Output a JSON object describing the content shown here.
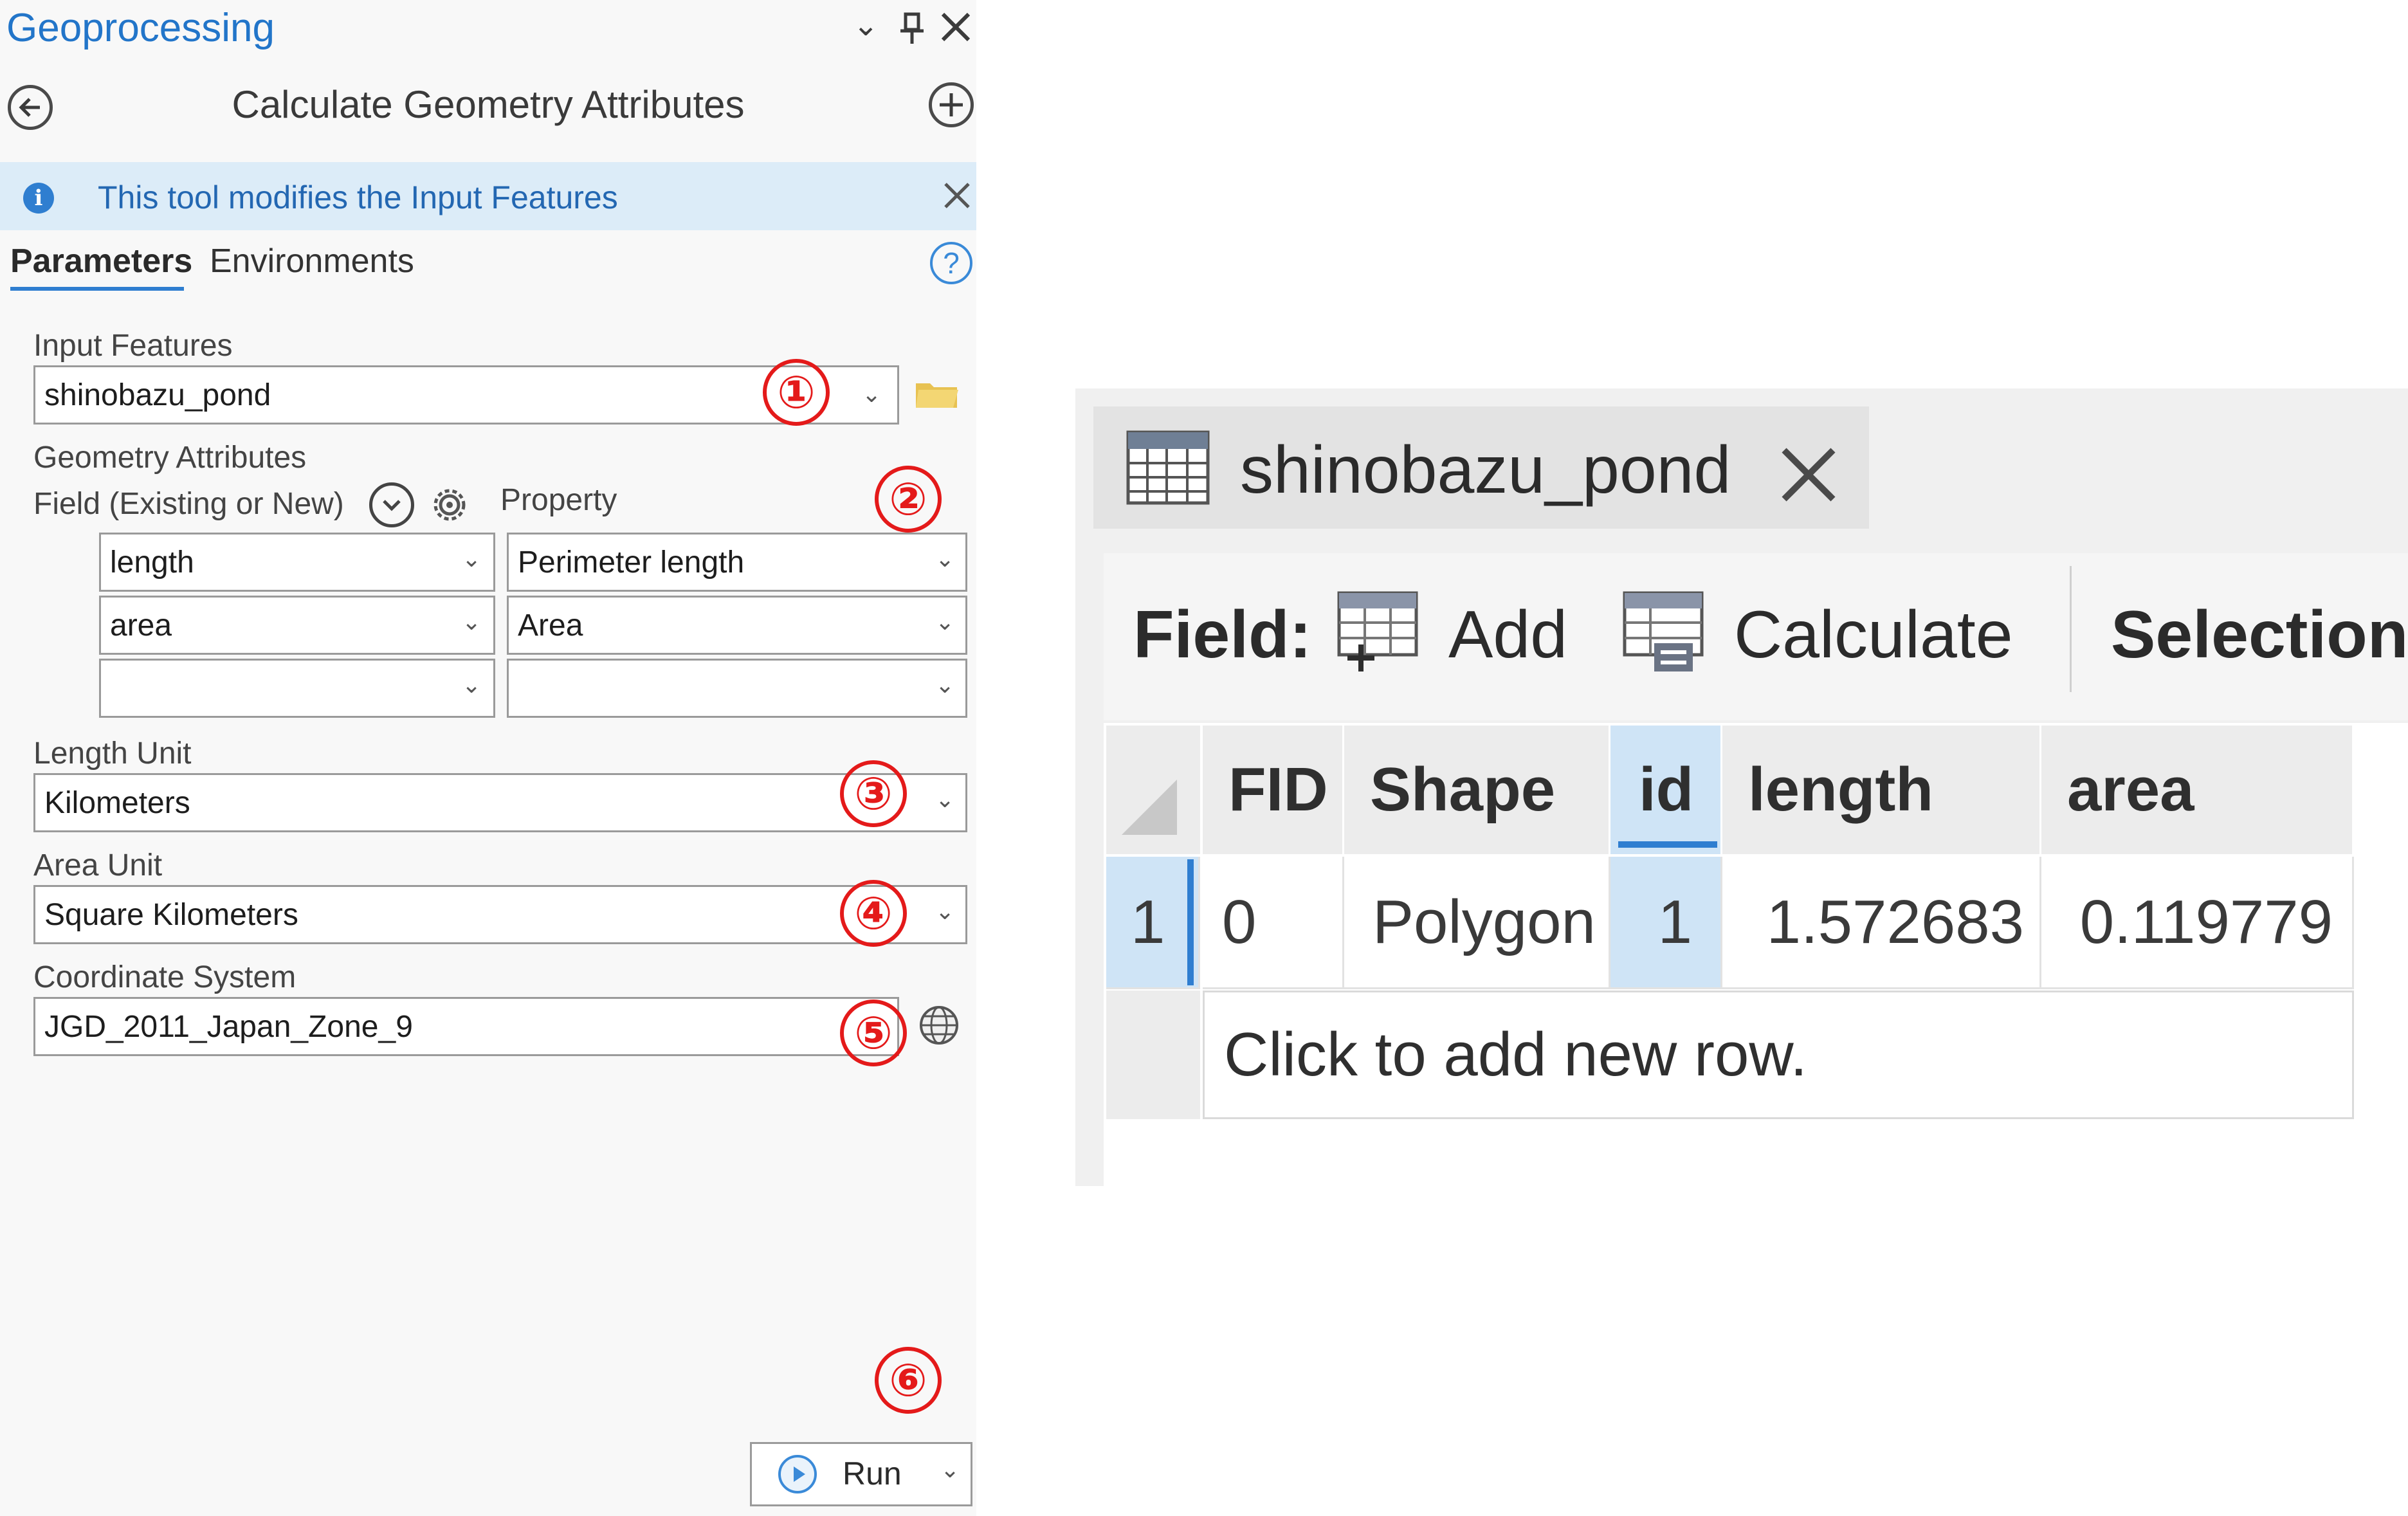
{
  "geoprocessing": {
    "panel_title": "Geoprocessing",
    "tool_title": "Calculate Geometry Attributes",
    "info_message": "This tool modifies the Input Features",
    "tabs": [
      {
        "label": "Parameters",
        "active": true
      },
      {
        "label": "Environments",
        "active": false
      }
    ],
    "input_features": {
      "label": "Input Features",
      "value": "shinobazu_pond"
    },
    "geometry_attributes": {
      "label": "Geometry Attributes",
      "field_header": "Field (Existing or New)",
      "property_header": "Property",
      "rows": [
        {
          "field": "length",
          "property": "Perimeter length"
        },
        {
          "field": "area",
          "property": "Area"
        },
        {
          "field": "",
          "property": ""
        }
      ]
    },
    "length_unit": {
      "label": "Length Unit",
      "value": "Kilometers"
    },
    "area_unit": {
      "label": "Area Unit",
      "value": "Square Kilometers"
    },
    "coordinate_system": {
      "label": "Coordinate System",
      "value": "JGD_2011_Japan_Zone_9"
    },
    "run_button": "Run",
    "markers": [
      "①",
      "②",
      "③",
      "④",
      "⑤",
      "⑥"
    ]
  },
  "attribute_table": {
    "tab_title": "shinobazu_pond",
    "toolbar": {
      "field_label": "Field:",
      "add_label": "Add",
      "calculate_label": "Calculate",
      "selection_label": "Selection:"
    },
    "columns": [
      "FID",
      "Shape",
      "id",
      "length",
      "area"
    ],
    "rows": [
      {
        "row_num": "1",
        "FID": "0",
        "Shape": "Polygon",
        "id": "1",
        "length": "1.572683",
        "area": "0.119779"
      }
    ],
    "new_row_text": "Click to add new row."
  },
  "colors": {
    "accent_blue": "#2f7ed0",
    "info_bar_bg": "#dcecf8",
    "marker_red": "#e41a1a",
    "selected_column_bg": "#cfe4f6"
  },
  "icons": [
    "chevron-down-icon",
    "pin-icon",
    "close-icon",
    "back-icon",
    "add-icon",
    "info-icon",
    "help-icon",
    "folder-icon",
    "expand-icon",
    "gear-icon",
    "globe-icon",
    "play-icon",
    "table-icon",
    "add-field-icon",
    "calculate-field-icon"
  ]
}
